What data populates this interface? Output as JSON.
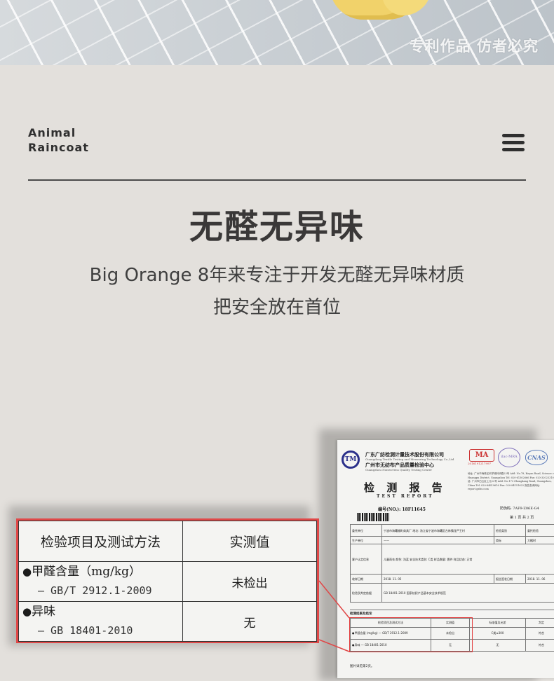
{
  "hero": {
    "watermark": "专利作品 仿者必究"
  },
  "header": {
    "brand_line1": "Animal",
    "brand_line2": "Raincoat",
    "menu_icon": "hamburger-menu-icon"
  },
  "main": {
    "headline": "无醛无异味",
    "subtitle_line1": "Big Orange 8年来专注于开发无醛无异味材质",
    "subtitle_line2": "把安全放在首位"
  },
  "report": {
    "org_cn_1": "广东广纺检测计量技术股份有限公司",
    "org_en_1": "Guangdong Textile Testing and Measuring Technology Co.,Ltd",
    "org_cn_2": "广州市无纺布产品质量检验中心",
    "org_en_2": "Guangzhou Nonwovens Quality Testing Center",
    "stamp_ma": "MA",
    "stamp_ma_no": "2016191217997",
    "stamp_ilac": "ilac-MRA",
    "stamp_cnas": "CNAS",
    "address": "地址: 广州市海珠区科学城科研路23号 Add: No.78, Keyan Road, Science city, Huangpu District, Guangzhou Tel: 020-61302666 Fax: 020-32023310 电话: 广州市白云区上元22号 Add: No.173 Zhongkang Road, Guangzhou, China Tel: 020-84619616 Fax: 020-84151622 报告查询网址: report.gzfzs.com",
    "title_cn": "检 测 报 告",
    "title_en": "TEST REPORT",
    "report_no": "编号(NO.): 18F11645",
    "anti_fake": "防伪码: 7AF9-Z06E-G4",
    "page_info": "第 1 页 共 2 页",
    "rows": [
      [
        "委托单位",
        "宁波市海曙福町商具厂 地址: 浙江省宁波市海曙区古林镇龙严王村",
        "检验类别",
        "委托检验"
      ],
      [
        "生产单位",
        "——",
        "商标",
        "大橘时"
      ],
      [
        "客户认定信息",
        "儿童雨衣 颜色: 浅蓝 安全技术类别: C类 样品数量: 壹件 样品状态: 正常",
        "",
        ""
      ],
      [
        "收样日期",
        "2018. 11. 05",
        "报告签发日期",
        "2018. 11. 06"
      ],
      [
        "检验及判定依据",
        "GB 18401-2010 国家纺织产品基本安全技术规范",
        "",
        ""
      ]
    ],
    "results_title": "检测结果及结论",
    "result_headers": [
      "检验项目及测试方法",
      "实测值",
      "标准值及允差",
      "判定"
    ],
    "result_rows": [
      [
        "●甲醛含量 (mg/kg) — GB/T 2912.1-2009",
        "未检出",
        "C类≤300",
        "符合"
      ],
      [
        "●异味 — GB 18401-2010",
        "无",
        "无",
        "符合"
      ]
    ],
    "footer": "图片详见第2页。"
  },
  "zoom_table": {
    "header_item": "检验项目及测试方法",
    "header_value": "实测值",
    "rows": [
      {
        "name": "甲醛含量（mg/kg）",
        "method": "— GB/T 2912.1-2009",
        "value": "未检出"
      },
      {
        "name": "异味",
        "method": "— GB 18401-2010",
        "value": "无"
      }
    ]
  },
  "colors": {
    "background": "#e3e0dc",
    "highlight": "#e04848",
    "text": "#3a3a3a"
  }
}
